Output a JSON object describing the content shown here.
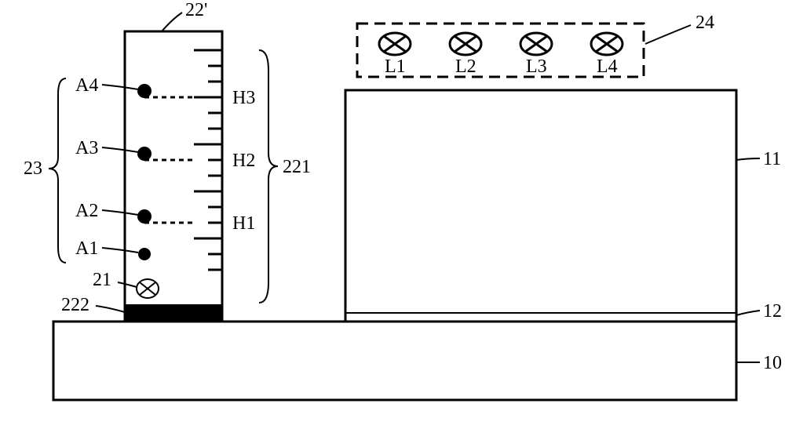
{
  "labels": {
    "col22p": "22'",
    "col221": "221",
    "col222": "222",
    "col23": "23",
    "col21": "21",
    "box24": "24",
    "box11": "11",
    "line12": "12",
    "base10": "10",
    "A1": "A1",
    "A2": "A2",
    "A3": "A3",
    "A4": "A4",
    "H1": "H1",
    "H2": "H2",
    "H3": "H3",
    "L1": "L1",
    "L2": "L2",
    "L3": "L3",
    "L4": "L4"
  }
}
